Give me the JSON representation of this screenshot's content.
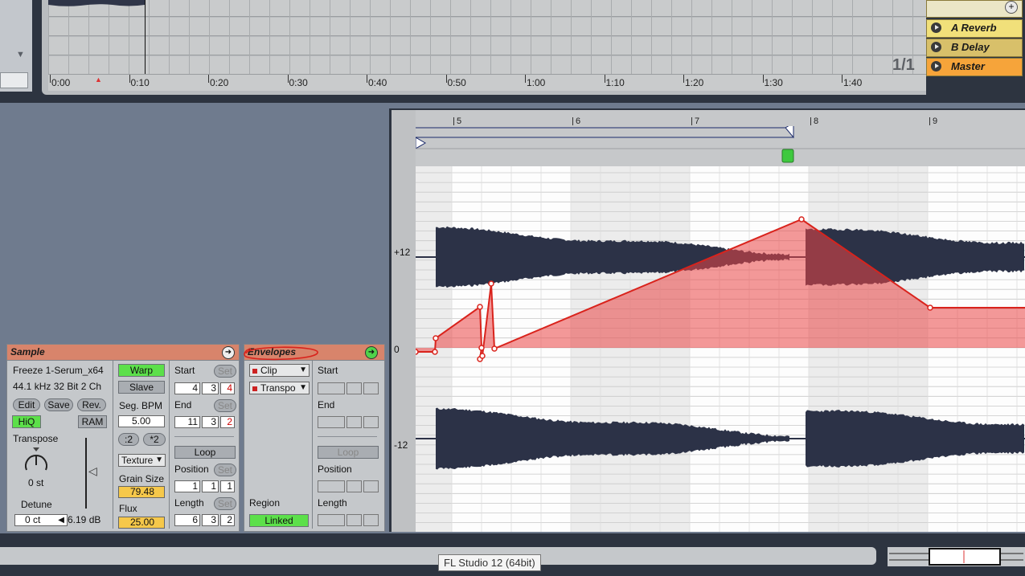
{
  "arrangement": {
    "time_labels": [
      "0:00",
      "0:10",
      "0:20",
      "0:30",
      "0:40",
      "0:50",
      "1:00",
      "1:10",
      "1:20",
      "1:30",
      "1:40"
    ],
    "returns": [
      {
        "label": "A Reverb",
        "color": "#f1e07a"
      },
      {
        "label": "B Delay",
        "color": "#d8c06a"
      },
      {
        "label": "Master",
        "color": "#f6a43a"
      }
    ],
    "page_fraction": "1/1",
    "add_icon": "plus-icon"
  },
  "clip_view": {
    "bars": [
      "5",
      "6",
      "7",
      "8",
      "9"
    ],
    "db_labels": [
      "+12",
      "0",
      "-12"
    ]
  },
  "sample": {
    "title": "Sample",
    "clip_name": "Freeze 1-Serum_x64",
    "format": "44.1 kHz 32 Bit 2 Ch",
    "edit": "Edit",
    "save": "Save",
    "rev": "Rev.",
    "hiq": "HiQ",
    "ram": "RAM",
    "transpose_label": "Transpose",
    "transpose_value": "0 st",
    "detune_label": "Detune",
    "detune_value": "0 ct",
    "gain_value": "6.19 dB",
    "warp": "Warp",
    "slave": "Slave",
    "seg_bpm_label": "Seg. BPM",
    "seg_bpm": "5.00",
    "half": ":2",
    "double": "*2",
    "mode": "Texture",
    "grain_label": "Grain Size",
    "grain": "79.48",
    "flux_label": "Flux",
    "flux": "25.00",
    "start_label": "Start",
    "set": "Set",
    "start": [
      "4",
      "3",
      "4"
    ],
    "end_label": "End",
    "end": [
      "11",
      "3",
      "2"
    ],
    "loop": "Loop",
    "position_label": "Position",
    "position": [
      "1",
      "1",
      "1"
    ],
    "length_label": "Length",
    "length": [
      "6",
      "3",
      "2"
    ]
  },
  "envelopes": {
    "title": "Envelopes",
    "device": "Clip",
    "control": "Transpo",
    "region_label": "Region",
    "linked": "Linked",
    "start_label": "Start",
    "end_label": "End",
    "loop": "Loop",
    "position_label": "Position",
    "length_label": "Length"
  },
  "tooltip": "FL Studio 12 (64bit)"
}
